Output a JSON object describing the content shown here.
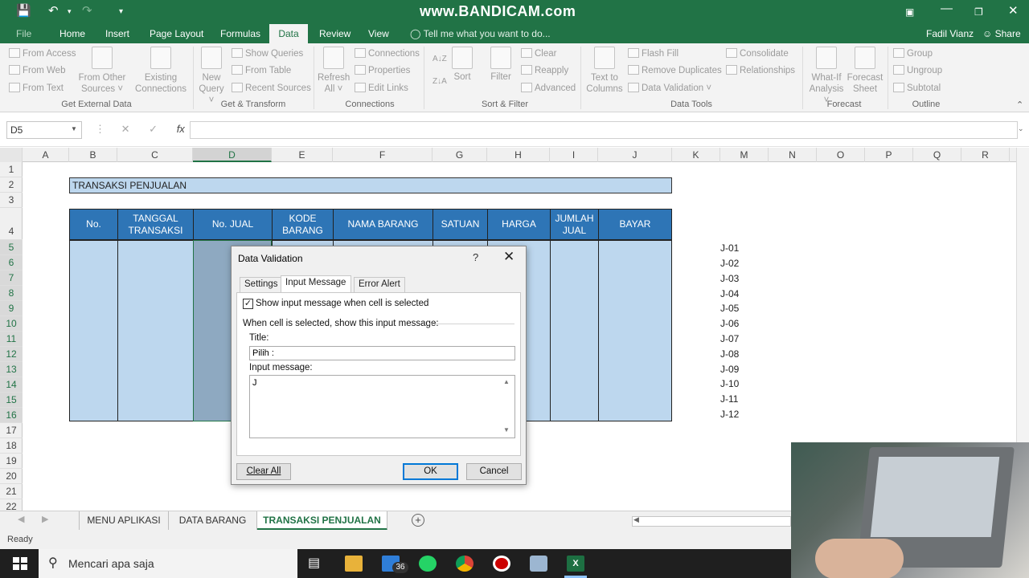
{
  "watermark": "www.BANDICAM.com",
  "tabs": {
    "file": "File",
    "home": "Home",
    "insert": "Insert",
    "page_layout": "Page Layout",
    "formulas": "Formulas",
    "data": "Data",
    "review": "Review",
    "view": "View"
  },
  "tell_me": "Tell me what you want to do...",
  "user": "Fadil Vianz",
  "share": "Share",
  "ribbon": {
    "from_access": "From Access",
    "from_web": "From Web",
    "from_text": "From Text",
    "from_other_1": "From Other",
    "from_other_2": "Sources ˅",
    "existing_1": "Existing",
    "existing_2": "Connections",
    "group_external": "Get External Data",
    "new_query_1": "New",
    "new_query_2": "Query ˅",
    "show_queries": "Show Queries",
    "from_table": "From Table",
    "recent_sources": "Recent Sources",
    "group_transform": "Get & Transform",
    "refresh_1": "Refresh",
    "refresh_2": "All ˅",
    "connections": "Connections",
    "properties": "Properties",
    "edit_links": "Edit Links",
    "group_connections": "Connections",
    "sort": "Sort",
    "filter": "Filter",
    "clear": "Clear",
    "reapply": "Reapply",
    "advanced": "Advanced",
    "group_sort": "Sort & Filter",
    "text_cols_1": "Text to",
    "text_cols_2": "Columns",
    "flash_fill": "Flash Fill",
    "remove_dup": "Remove Duplicates",
    "data_validation": "Data Validation ˅",
    "consolidate": "Consolidate",
    "relationships": "Relationships",
    "group_tools": "Data Tools",
    "whatif_1": "What-If",
    "whatif_2": "Analysis ˅",
    "forecast_1": "Forecast",
    "forecast_2": "Sheet",
    "group_forecast": "Forecast",
    "group": "Group",
    "ungroup": "Ungroup",
    "subtotal": "Subtotal",
    "group_outline": "Outline"
  },
  "name_box": "D5",
  "columns": [
    "A",
    "B",
    "C",
    "D",
    "E",
    "F",
    "G",
    "H",
    "I",
    "J",
    "K",
    "M",
    "N",
    "O",
    "P",
    "Q",
    "R"
  ],
  "rows": [
    "1",
    "2",
    "3",
    "4",
    "5",
    "6",
    "7",
    "8",
    "9",
    "10",
    "11",
    "12",
    "13",
    "14",
    "15",
    "16",
    "17",
    "18",
    "19",
    "20",
    "21",
    "22"
  ],
  "sheet": {
    "title": "TRANSAKSI PENJUALAN",
    "headers": {
      "no": "No.",
      "tanggal_1": "TANGGAL",
      "tanggal_2": "TRANSAKSI",
      "no_jual": "No. JUAL",
      "kode_1": "KODE",
      "kode_2": "BARANG",
      "nama": "NAMA BARANG",
      "satuan": "SATUAN",
      "harga": "HARGA",
      "jumlah_1": "JUMLAH",
      "jumlah_2": "JUAL",
      "bayar": "BAYAR"
    },
    "j_list": [
      "J-01",
      "J-02",
      "J-03",
      "J-04",
      "J-05",
      "J-06",
      "J-07",
      "J-08",
      "J-09",
      "J-10",
      "J-11",
      "J-12"
    ]
  },
  "sheet_tabs": [
    "MENU APLIKASI",
    "DATA BARANG",
    "TRANSAKSI PENJUALAN"
  ],
  "status": "Ready",
  "taskbar": {
    "search_placeholder": "Mencari apa saja",
    "mail_badge": "36"
  },
  "dialog": {
    "title": "Data Validation",
    "help": "?",
    "tabs": [
      "Settings",
      "Input Message",
      "Error Alert"
    ],
    "checkbox_label": "Show input message when cell is selected",
    "checked": true,
    "section_label": "When cell is selected, show this input message:",
    "title_label": "Title:",
    "title_value": "Pilih :",
    "message_label": "Input message:",
    "message_value": "J",
    "clear_all": "Clear All",
    "ok": "OK",
    "cancel": "Cancel"
  },
  "colors": {
    "excel_green": "#217346",
    "header_blue": "#2e75b6",
    "cell_blue": "#bdd7ee"
  }
}
